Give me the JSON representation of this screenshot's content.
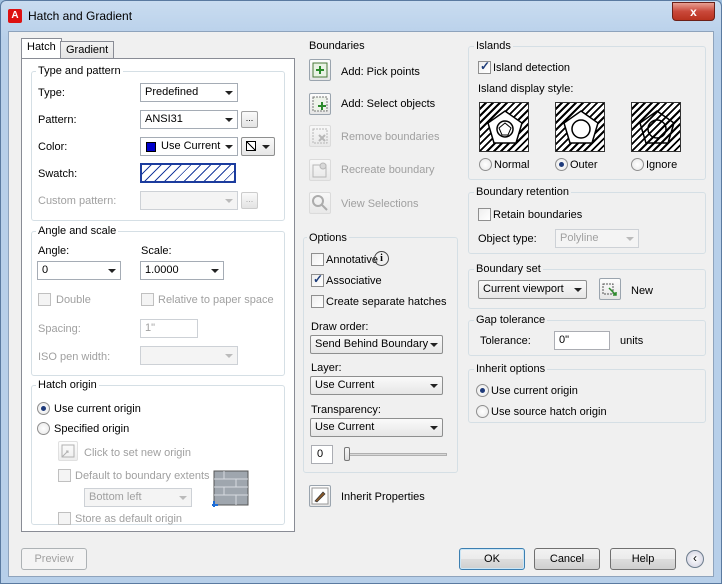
{
  "window": {
    "title": "Hatch and Gradient",
    "close_glyph": "x"
  },
  "tabs": [
    {
      "label": "Hatch"
    },
    {
      "label": "Gradient"
    }
  ],
  "type_pattern": {
    "title": "Type and pattern",
    "type_label": "Type:",
    "type_value": "Predefined",
    "pattern_label": "Pattern:",
    "pattern_value": "ANSI31",
    "dots": "...",
    "color_label": "Color:",
    "color_value": "Use Current",
    "color_swatch": "#0000cc",
    "swatch_label": "Swatch:",
    "custom_pattern_label": "Custom pattern:"
  },
  "angle_scale": {
    "title": "Angle and scale",
    "angle_label": "Angle:",
    "angle_value": "0",
    "scale_label": "Scale:",
    "scale_value": "1.0000",
    "double_label": "Double",
    "relative_label": "Relative to paper space",
    "spacing_label": "Spacing:",
    "spacing_value": "1\"",
    "iso_label": "ISO pen width:"
  },
  "hatch_origin": {
    "title": "Hatch origin",
    "use_current_label": "Use current origin",
    "specified_label": "Specified origin",
    "click_label": "Click to set new origin",
    "default_extents_label": "Default to boundary extents",
    "position_value": "Bottom left",
    "store_label": "Store as default origin"
  },
  "boundaries": {
    "title": "Boundaries",
    "pick_points": "Add: Pick points",
    "select_objects": "Add: Select objects",
    "remove": "Remove boundaries",
    "recreate": "Recreate boundary",
    "view": "View Selections"
  },
  "options": {
    "title": "Options",
    "annotative": "Annotative",
    "associative": "Associative",
    "separate": "Create separate hatches",
    "draw_order_label": "Draw order:",
    "draw_order_value": "Send Behind Boundary",
    "layer_label": "Layer:",
    "layer_value": "Use Current",
    "transparency_label": "Transparency:",
    "transparency_value": "Use Current",
    "transparency_number": "0",
    "inherit": "Inherit Properties"
  },
  "islands": {
    "title": "Islands",
    "detection_label": "Island detection",
    "style_label": "Island display style:",
    "normal": "Normal",
    "outer": "Outer",
    "ignore": "Ignore"
  },
  "retention": {
    "title": "Boundary retention",
    "retain_label": "Retain boundaries",
    "object_type_label": "Object type:",
    "object_type_value": "Polyline"
  },
  "boundary_set": {
    "title": "Boundary set",
    "value": "Current viewport",
    "new_label": "New"
  },
  "gap": {
    "title": "Gap tolerance",
    "tolerance_label": "Tolerance:",
    "value": "0\"",
    "units": "units"
  },
  "inherit_options": {
    "title": "Inherit options",
    "use_current": "Use current origin",
    "use_source": "Use source hatch origin"
  },
  "footer": {
    "preview": "Preview",
    "ok": "OK",
    "cancel": "Cancel",
    "help": "Help",
    "expand_glyph": "‹"
  }
}
